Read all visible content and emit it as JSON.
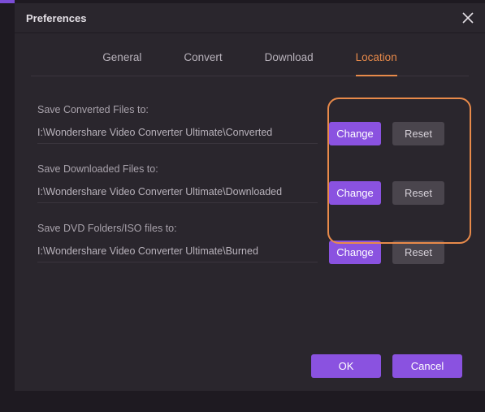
{
  "title": "Preferences",
  "tabs": [
    {
      "label": "General",
      "active": false
    },
    {
      "label": "Convert",
      "active": false
    },
    {
      "label": "Download",
      "active": false
    },
    {
      "label": "Location",
      "active": true
    }
  ],
  "fields": [
    {
      "label": "Save Converted Files to:",
      "value": "I:\\Wondershare Video Converter Ultimate\\Converted",
      "change": "Change",
      "reset": "Reset"
    },
    {
      "label": "Save Downloaded Files to:",
      "value": "I:\\Wondershare Video Converter Ultimate\\Downloaded",
      "change": "Change",
      "reset": "Reset"
    },
    {
      "label": "Save DVD Folders/ISO files to:",
      "value": "I:\\Wondershare Video Converter Ultimate\\Burned",
      "change": "Change",
      "reset": "Reset"
    }
  ],
  "footer": {
    "ok": "OK",
    "cancel": "Cancel"
  }
}
